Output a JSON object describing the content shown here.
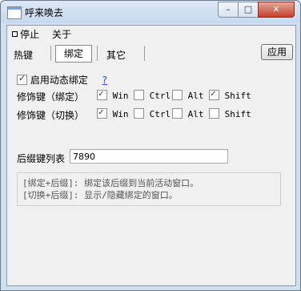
{
  "window": {
    "title": "呼来唤去",
    "icon": "window-app-icon",
    "controls": {
      "min": "–",
      "max": "□",
      "close": "✕"
    }
  },
  "menu": {
    "stop": "停止",
    "about": "关于"
  },
  "tabs": [
    {
      "label": "热键"
    },
    {
      "label": "绑定"
    },
    {
      "label": "其它"
    }
  ],
  "apply_label": "应用",
  "enable_dynamic": {
    "label": "启用动态绑定",
    "help": "?",
    "checked": true
  },
  "mod_bind": {
    "label": "修饰键（绑定）",
    "options": [
      {
        "label": "Win",
        "checked": true
      },
      {
        "label": "Ctrl",
        "checked": false
      },
      {
        "label": "Alt",
        "checked": false
      },
      {
        "label": "Shift",
        "checked": true
      }
    ]
  },
  "mod_switch": {
    "label": "修饰键（切换）",
    "options": [
      {
        "label": "Win",
        "checked": true
      },
      {
        "label": "Ctrl",
        "checked": false
      },
      {
        "label": "Alt",
        "checked": false
      },
      {
        "label": "Shift",
        "checked": false
      }
    ]
  },
  "suffix": {
    "label": "后缀键列表",
    "value": "7890"
  },
  "info": {
    "line1": "[绑定+后缀]: 绑定该后缀到当前活动窗口。",
    "line2": "[切换+后缀]: 显示/隐藏绑定的窗口。"
  }
}
